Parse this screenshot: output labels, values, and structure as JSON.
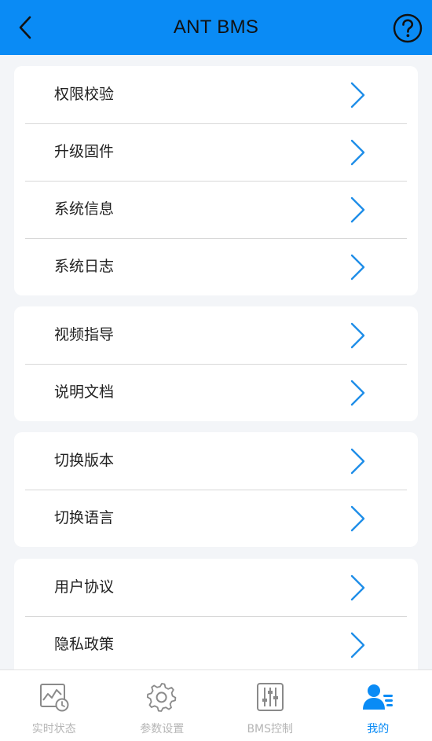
{
  "header": {
    "title": "ANT BMS"
  },
  "menu": {
    "group1": [
      {
        "label": "权限校验"
      },
      {
        "label": "升级固件"
      },
      {
        "label": "系统信息"
      },
      {
        "label": "系统日志"
      }
    ],
    "group2": [
      {
        "label": "视频指导"
      },
      {
        "label": "说明文档"
      }
    ],
    "group3": [
      {
        "label": "切换版本"
      },
      {
        "label": "切换语言"
      }
    ],
    "group4": [
      {
        "label": "用户协议"
      },
      {
        "label": "隐私政策"
      }
    ]
  },
  "tabbar": {
    "tabs": [
      {
        "label": "实时状态",
        "icon": "realtime-status-icon"
      },
      {
        "label": "参数设置",
        "icon": "gear-icon"
      },
      {
        "label": "BMS控制",
        "icon": "sliders-icon"
      },
      {
        "label": "我的",
        "icon": "user-list-icon"
      }
    ],
    "active_index": 3
  },
  "colors": {
    "accent": "#0a8bf5",
    "background": "#f3f5f8",
    "inactive": "#b5b5b5"
  }
}
